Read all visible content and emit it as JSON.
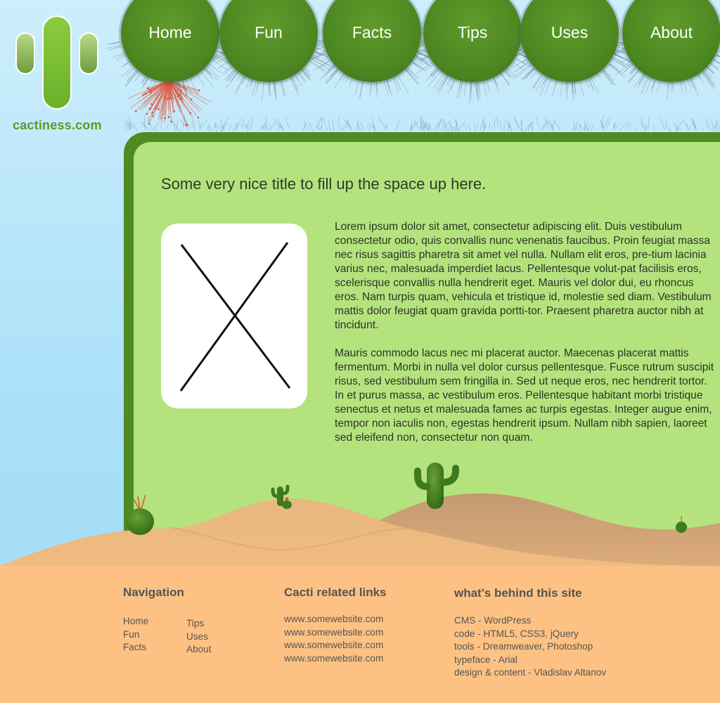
{
  "logo": {
    "text": "cactiness.com"
  },
  "nav": {
    "items": [
      "Home",
      "Fun",
      "Facts",
      "Tips",
      "Uses",
      "About"
    ]
  },
  "main": {
    "title": "Some very nice title to fill up the space up here.",
    "paragraphs": [
      "Lorem ipsum dolor sit amet, consectetur adipiscing elit. Duis vestibulum consectetur odio, quis convallis nunc venenatis faucibus. Proin feugiat massa nec risus sagittis pharetra sit amet vel nulla. Nullam elit eros, pre-tium lacinia varius nec, malesuada imperdiet lacus. Pellentesque volut-pat facilisis eros, scelerisque convallis nulla hendrerit eget. Mauris vel dolor dui, eu rhoncus eros. Nam turpis quam, vehicula et tristique id, molestie sed diam. Vestibulum mattis dolor feugiat quam gravida portti-tor. Praesent pharetra auctor nibh at tincidunt.",
      "Mauris commodo lacus nec mi placerat auctor. Maecenas placerat mattis fermentum. Morbi in nulla vel dolor cursus pellentesque. Fusce rutrum suscipit risus, sed vestibulum sem fringilla in. Sed ut neque eros, nec hendrerit tortor. In et purus massa, ac vestibulum eros. Pellentesque habitant morbi tristique senectus et netus et malesuada fames ac turpis egestas. Integer augue enim, tempor non iaculis non, egestas hendrerit ipsum. Nullam nibh sapien, laoreet sed eleifend non, consectetur non quam."
    ]
  },
  "footer": {
    "navigation": {
      "heading": "Navigation",
      "col1": [
        "Home",
        "Fun",
        "Facts"
      ],
      "col2": [
        "Tips",
        "Uses",
        "About"
      ]
    },
    "links": {
      "heading": "Cacti related links",
      "items": [
        "www.somewebsite.com",
        "www.somewebsite.com",
        "www.somewebsite.com",
        "www.somewebsite.com"
      ]
    },
    "behind": {
      "heading": "what's behind this site",
      "items": [
        "CMS - WordPress",
        "code - HTML5, CSS3, jQuery",
        "tools - Dreamweaver, Photoshop",
        "typeface - Arial",
        "design & content - Vladislav Altanov"
      ]
    }
  },
  "colors": {
    "sky": "#a9e0f8",
    "panel_border": "#4f8a23",
    "panel_fill": "#b4e37e",
    "nav_green": "#4e8a22",
    "sand": "#e8b27a",
    "footer_bg": "#fdc283",
    "logo_green": "#5e9a22"
  }
}
